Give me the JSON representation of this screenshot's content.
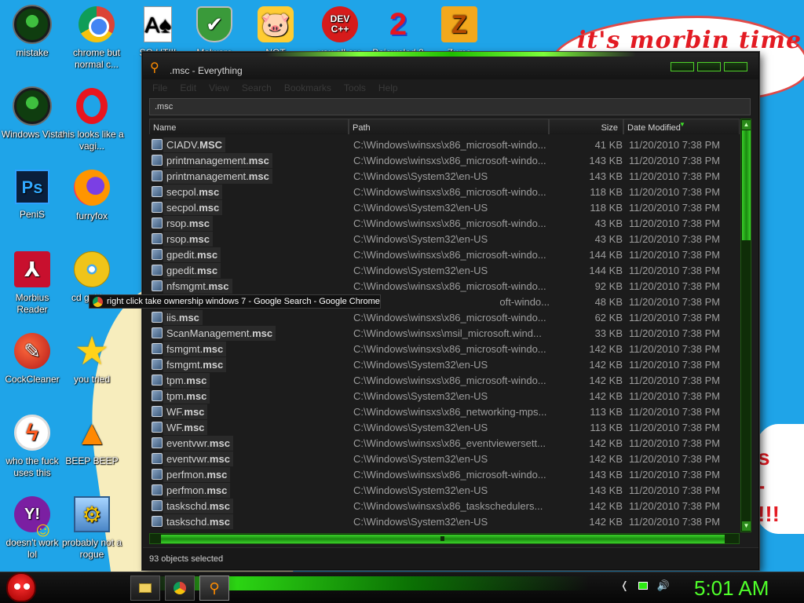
{
  "desktop": {
    "wallpaper_text": "it's morbin time",
    "wallpaper_text2": "s\n-\n!!!",
    "icons": [
      {
        "label": "mistake",
        "glyph": "",
        "style": "ball"
      },
      {
        "label": "chrome but normal c...",
        "glyph": "",
        "style": "chrome"
      },
      {
        "label": "SO UT!!!",
        "glyph": "A♠",
        "style": "card"
      },
      {
        "label": "Malware",
        "glyph": "✔",
        "style": "shield"
      },
      {
        "label": "NOT",
        "glyph": "🐷",
        "style": "pig"
      },
      {
        "label": "you all are",
        "glyph": "DEV C++",
        "style": "dev"
      },
      {
        "label": "Bejeweled 2",
        "glyph": "2",
        "style": "two"
      },
      {
        "label": "Zuma",
        "glyph": "Z",
        "style": "zuma"
      },
      {
        "label": "Windows Vista",
        "glyph": "",
        "style": "ball"
      },
      {
        "label": "this looks like a vagi...",
        "glyph": "",
        "style": "opera"
      },
      {
        "label": "PeniS",
        "glyph": "Ps",
        "style": "ps"
      },
      {
        "label": "furryfox",
        "glyph": "",
        "style": "fox"
      },
      {
        "label": "Morbius Reader",
        "glyph": "⅄",
        "style": "pdf"
      },
      {
        "label": "cd golden",
        "glyph": "",
        "style": "cd"
      },
      {
        "label": "CockCleaner",
        "glyph": "✎",
        "style": "cc"
      },
      {
        "label": "you tried",
        "glyph": "★",
        "style": "star"
      },
      {
        "label": "who the fuck uses this",
        "glyph": "ϟ",
        "style": "bolt"
      },
      {
        "label": "BEEP BEEP",
        "glyph": "▲",
        "style": "vlc"
      },
      {
        "label": "doesn't work lol",
        "glyph": "Y!",
        "style": "yahoo"
      },
      {
        "label": "probably not a rogue",
        "glyph": "⚙",
        "style": "gear"
      }
    ]
  },
  "window": {
    "title": ".msc - Everything",
    "search_value": ".msc",
    "menu": [
      "File",
      "Edit",
      "View",
      "Search",
      "Bookmarks",
      "Tools",
      "Help"
    ],
    "columns": {
      "name": "Name",
      "path": "Path",
      "size": "Size",
      "date": "Date Modified"
    },
    "rows": [
      {
        "stem": "CIADV.",
        "ext": "MSC",
        "path": "C:\\Windows\\winsxs\\x86_microsoft-windo...",
        "size": "41 KB",
        "date": "11/20/2010 7:38 PM"
      },
      {
        "stem": "printmanagement.",
        "ext": "msc",
        "path": "C:\\Windows\\winsxs\\x86_microsoft-windo...",
        "size": "143 KB",
        "date": "11/20/2010 7:38 PM"
      },
      {
        "stem": "printmanagement.",
        "ext": "msc",
        "path": "C:\\Windows\\System32\\en-US",
        "size": "143 KB",
        "date": "11/20/2010 7:38 PM"
      },
      {
        "stem": "secpol.",
        "ext": "msc",
        "path": "C:\\Windows\\winsxs\\x86_microsoft-windo...",
        "size": "118 KB",
        "date": "11/20/2010 7:38 PM"
      },
      {
        "stem": "secpol.",
        "ext": "msc",
        "path": "C:\\Windows\\System32\\en-US",
        "size": "118 KB",
        "date": "11/20/2010 7:38 PM"
      },
      {
        "stem": "rsop.",
        "ext": "msc",
        "path": "C:\\Windows\\winsxs\\x86_microsoft-windo...",
        "size": "43 KB",
        "date": "11/20/2010 7:38 PM"
      },
      {
        "stem": "rsop.",
        "ext": "msc",
        "path": "C:\\Windows\\System32\\en-US",
        "size": "43 KB",
        "date": "11/20/2010 7:38 PM"
      },
      {
        "stem": "gpedit.",
        "ext": "msc",
        "path": "C:\\Windows\\winsxs\\x86_microsoft-windo...",
        "size": "144 KB",
        "date": "11/20/2010 7:38 PM"
      },
      {
        "stem": "gpedit.",
        "ext": "msc",
        "path": "C:\\Windows\\System32\\en-US",
        "size": "144 KB",
        "date": "11/20/2010 7:38 PM"
      },
      {
        "stem": "nfsmgmt.",
        "ext": "msc",
        "path": "C:\\Windows\\winsxs\\x86_microsoft-windo...",
        "size": "92 KB",
        "date": "11/20/2010 7:38 PM"
      },
      {
        "stem": "",
        "ext": "",
        "path": "oft-windo...",
        "size": "48 KB",
        "date": "11/20/2010 7:38 PM"
      },
      {
        "stem": "iis.",
        "ext": "msc",
        "path": "C:\\Windows\\winsxs\\x86_microsoft-windo...",
        "size": "62 KB",
        "date": "11/20/2010 7:38 PM"
      },
      {
        "stem": "ScanManagement.",
        "ext": "msc",
        "path": "C:\\Windows\\winsxs\\msil_microsoft.wind...",
        "size": "33 KB",
        "date": "11/20/2010 7:38 PM"
      },
      {
        "stem": "fsmgmt.",
        "ext": "msc",
        "path": "C:\\Windows\\winsxs\\x86_microsoft-windo...",
        "size": "142 KB",
        "date": "11/20/2010 7:38 PM"
      },
      {
        "stem": "fsmgmt.",
        "ext": "msc",
        "path": "C:\\Windows\\System32\\en-US",
        "size": "142 KB",
        "date": "11/20/2010 7:38 PM"
      },
      {
        "stem": "tpm.",
        "ext": "msc",
        "path": "C:\\Windows\\winsxs\\x86_microsoft-windo...",
        "size": "142 KB",
        "date": "11/20/2010 7:38 PM"
      },
      {
        "stem": "tpm.",
        "ext": "msc",
        "path": "C:\\Windows\\System32\\en-US",
        "size": "142 KB",
        "date": "11/20/2010 7:38 PM"
      },
      {
        "stem": "WF.",
        "ext": "msc",
        "path": "C:\\Windows\\winsxs\\x86_networking-mps...",
        "size": "113 KB",
        "date": "11/20/2010 7:38 PM"
      },
      {
        "stem": "WF.",
        "ext": "msc",
        "path": "C:\\Windows\\System32\\en-US",
        "size": "113 KB",
        "date": "11/20/2010 7:38 PM"
      },
      {
        "stem": "eventvwr.",
        "ext": "msc",
        "path": "C:\\Windows\\winsxs\\x86_eventviewersett...",
        "size": "142 KB",
        "date": "11/20/2010 7:38 PM"
      },
      {
        "stem": "eventvwr.",
        "ext": "msc",
        "path": "C:\\Windows\\System32\\en-US",
        "size": "142 KB",
        "date": "11/20/2010 7:38 PM"
      },
      {
        "stem": "perfmon.",
        "ext": "msc",
        "path": "C:\\Windows\\winsxs\\x86_microsoft-windo...",
        "size": "143 KB",
        "date": "11/20/2010 7:38 PM"
      },
      {
        "stem": "perfmon.",
        "ext": "msc",
        "path": "C:\\Windows\\System32\\en-US",
        "size": "143 KB",
        "date": "11/20/2010 7:38 PM"
      },
      {
        "stem": "taskschd.",
        "ext": "msc",
        "path": "C:\\Windows\\winsxs\\x86_taskschedulers...",
        "size": "142 KB",
        "date": "11/20/2010 7:38 PM"
      },
      {
        "stem": "taskschd.",
        "ext": "msc",
        "path": "C:\\Windows\\System32\\en-US",
        "size": "142 KB",
        "date": "11/20/2010 7:38 PM"
      }
    ],
    "status": "93 objects selected"
  },
  "tooltip": {
    "text": "right click take ownership windows 7 - Google Search - Google Chrome"
  },
  "taskbar": {
    "clock": "5:01 AM",
    "tray_back": "❬",
    "tray_volume": "🔊"
  },
  "colors": {
    "accent": "#2eea13",
    "window_bg": "#1c1c1c",
    "desktop": "#1fa4e8"
  }
}
